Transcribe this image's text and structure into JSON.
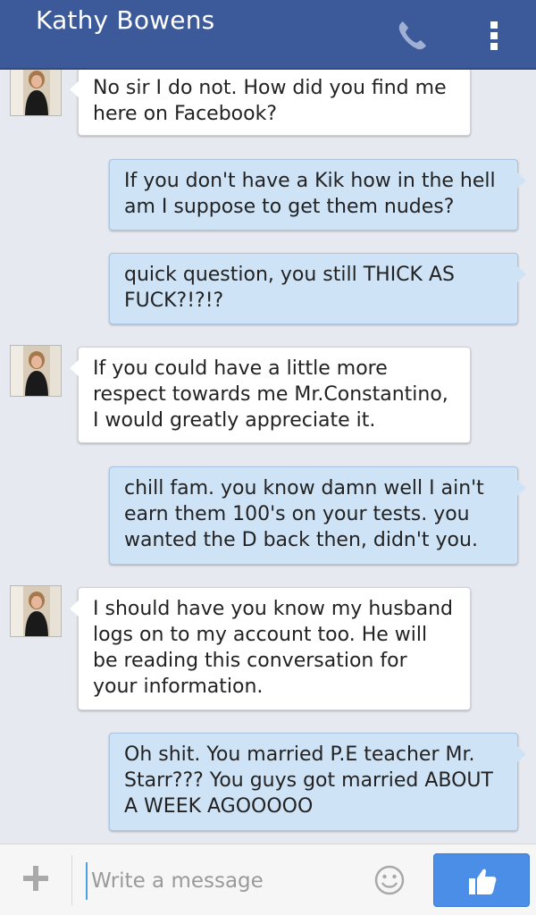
{
  "header": {
    "contact_name": "Kathy Bowens",
    "call_icon": "phone-icon",
    "menu_icon": "overflow-menu-icon"
  },
  "messages": [
    {
      "direction": "incoming",
      "text": "No sir I do not. How did you find me here on Facebook?"
    },
    {
      "direction": "outgoing",
      "text": "If you don't have a Kik how in the hell am I suppose to get them nudes?"
    },
    {
      "direction": "outgoing",
      "text": "quick question,  you still THICK AS FUCK?!?!?"
    },
    {
      "direction": "incoming",
      "text": "If you could have a little more respect towards me Mr.Constantino, I would greatly appreciate it."
    },
    {
      "direction": "outgoing",
      "text": "chill fam. you know damn well I ain't earn them 100's on your tests. you wanted the D back then, didn't you."
    },
    {
      "direction": "incoming",
      "text": "I should have you know my husband logs on to my account too. He will be reading this conversation for your information."
    },
    {
      "direction": "outgoing",
      "text": "Oh shit.  You married P.E teacher Mr. Starr??? You guys got married ABOUT A WEEK AGOOOOO"
    }
  ],
  "composer": {
    "placeholder": "Write a message",
    "value": "",
    "add_icon": "plus-icon",
    "emoji_icon": "emoji-icon",
    "like_icon": "thumbs-up-icon"
  },
  "colors": {
    "header_bg": "#3c5a99",
    "incoming_bubble": "#ffffff",
    "outgoing_bubble": "#cfe3f7",
    "like_button": "#4b8ee8"
  }
}
